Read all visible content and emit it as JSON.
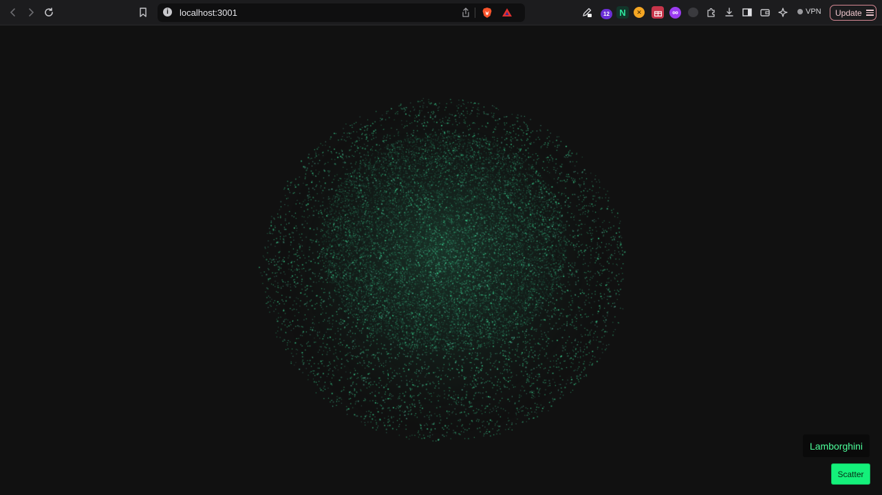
{
  "browser": {
    "url": "localhost:3001",
    "vpn_label": "VPN",
    "update_label": "Update",
    "extension_badge_count": "12",
    "extension_n_letter": "N"
  },
  "app": {
    "label": "Lamborghini",
    "scatter_button_label": "Scatter",
    "particle_color": "#3ddc97",
    "accent_color": "#14f07a",
    "label_color": "#4dff9a"
  }
}
